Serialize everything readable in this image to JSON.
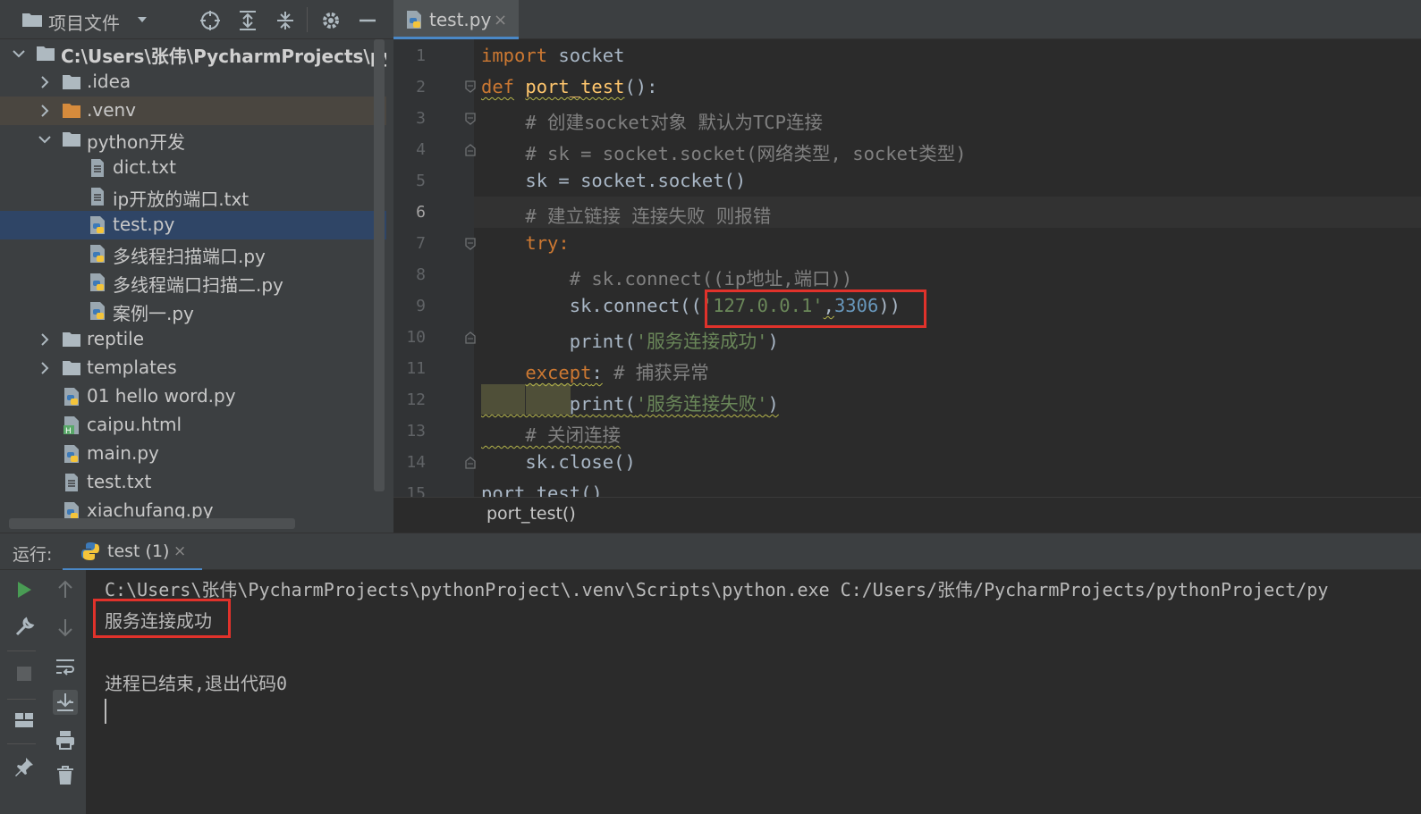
{
  "project_panel": {
    "title": "项目文件",
    "tools": [
      "locate-icon",
      "expand-all-icon",
      "collapse-all-icon",
      "gear-icon",
      "minimize-icon"
    ],
    "tree": [
      {
        "label": "C:\\Users\\张伟\\PycharmProjects\\pytho",
        "type": "folder",
        "depth": 0,
        "expanded": true,
        "root": true
      },
      {
        "label": ".idea",
        "type": "folder",
        "depth": 1,
        "expanded": false
      },
      {
        "label": ".venv",
        "type": "folder-venv",
        "depth": 1,
        "expanded": false
      },
      {
        "label": "python开发",
        "type": "folder",
        "depth": 1,
        "expanded": true
      },
      {
        "label": "dict.txt",
        "type": "text",
        "depth": 2
      },
      {
        "label": "ip开放的端口.txt",
        "type": "text",
        "depth": 2
      },
      {
        "label": "test.py",
        "type": "python",
        "depth": 2,
        "selected": true
      },
      {
        "label": "多线程扫描端口.py",
        "type": "python",
        "depth": 2
      },
      {
        "label": "多线程端口扫描二.py",
        "type": "python",
        "depth": 2
      },
      {
        "label": "案例一.py",
        "type": "python",
        "depth": 2
      },
      {
        "label": "reptile",
        "type": "folder",
        "depth": 1,
        "expanded": false
      },
      {
        "label": "templates",
        "type": "folder",
        "depth": 1,
        "expanded": false
      },
      {
        "label": "01 hello word.py",
        "type": "python",
        "depth": 1
      },
      {
        "label": "caipu.html",
        "type": "html",
        "depth": 1
      },
      {
        "label": "main.py",
        "type": "python",
        "depth": 1
      },
      {
        "label": "test.txt",
        "type": "text",
        "depth": 1
      },
      {
        "label": "xiachufang.py",
        "type": "python",
        "depth": 1
      }
    ]
  },
  "editor": {
    "tab": {
      "label": "test.py",
      "close": "×"
    },
    "current_line": 6,
    "line_numbers": [
      "1",
      "2",
      "3",
      "4",
      "5",
      "6",
      "7",
      "8",
      "9",
      "10",
      "11",
      "12",
      "13",
      "14",
      "15"
    ],
    "lines": [
      {
        "n": "1",
        "plain": "import socket"
      },
      {
        "n": "2",
        "plain": "def port_test():"
      },
      {
        "n": "3",
        "plain": "    # 创建socket对象 默认为TCP连接"
      },
      {
        "n": "4",
        "plain": "    # sk = socket.socket(网络类型, socket类型)"
      },
      {
        "n": "5",
        "plain": "    sk = socket.socket()"
      },
      {
        "n": "6",
        "plain": "    # 建立链接 连接失败 则报错"
      },
      {
        "n": "7",
        "plain": "    try:"
      },
      {
        "n": "8",
        "plain": "        # sk.connect((ip地址,端口))"
      },
      {
        "n": "9",
        "plain": "        sk.connect(('127.0.0.1',3306))"
      },
      {
        "n": "10",
        "plain": "        print('服务连接成功')"
      },
      {
        "n": "11",
        "plain": "    except: # 捕获异常"
      },
      {
        "n": "12",
        "plain": "        print('服务连接失败')"
      },
      {
        "n": "13",
        "plain": "    # 关闭连接"
      },
      {
        "n": "14",
        "plain": "    sk.close()"
      },
      {
        "n": "15",
        "plain": "port_test()"
      }
    ],
    "tokens": {
      "import": "import",
      "socket_mod": "socket",
      "def": "def",
      "fn_name": "port_test",
      "fn_paren": "():",
      "c3": "# 创建socket对象 默认为TCP连接",
      "c4": "# sk = socket.socket(网络类型, socket类型)",
      "l5": "sk = socket.socket()",
      "c6": "# 建立链接 连接失败 则报错",
      "try": "try",
      "colon": ":",
      "c8": "# sk.connect((ip地址,端口))",
      "l9_pre": "sk.connect((",
      "l9_str": "'127.0.0.1'",
      "l9_comma": ",",
      "l9_num": "3306",
      "l9_post": "))",
      "print": "print(",
      "s10": "'服务连接成功'",
      "rparen": ")",
      "except": "except",
      "c11": "# 捕获异常",
      "s12": "'服务连接失败'",
      "c13": "# 关闭连接",
      "l14": "sk.close()",
      "l15": "port_test()"
    },
    "breadcrumb": "port_test()"
  },
  "run_panel": {
    "label": "运行:",
    "tab": {
      "label": "test (1)",
      "close": "×"
    },
    "toolbar": [
      "run-icon",
      "rerun-up-icon",
      "wrench-icon",
      "down-icon",
      "stop-icon",
      "soft-wrap-icon",
      "layout-icon",
      "scroll-to-end-icon",
      "print-icon",
      "pin-icon",
      "trash-icon"
    ],
    "console": [
      "C:\\Users\\张伟\\PycharmProjects\\pythonProject\\.venv\\Scripts\\python.exe C:/Users/张伟/PycharmProjects/pythonProject/py",
      "服务连接成功",
      "",
      "进程已结束,退出代码0"
    ]
  },
  "colors": {
    "accent": "#4a88c7",
    "highlight_box": "#e0322b",
    "keyword": "#cc7832",
    "function": "#ffc66d",
    "string": "#6a8759",
    "number": "#6897bb",
    "comment": "#808080"
  }
}
